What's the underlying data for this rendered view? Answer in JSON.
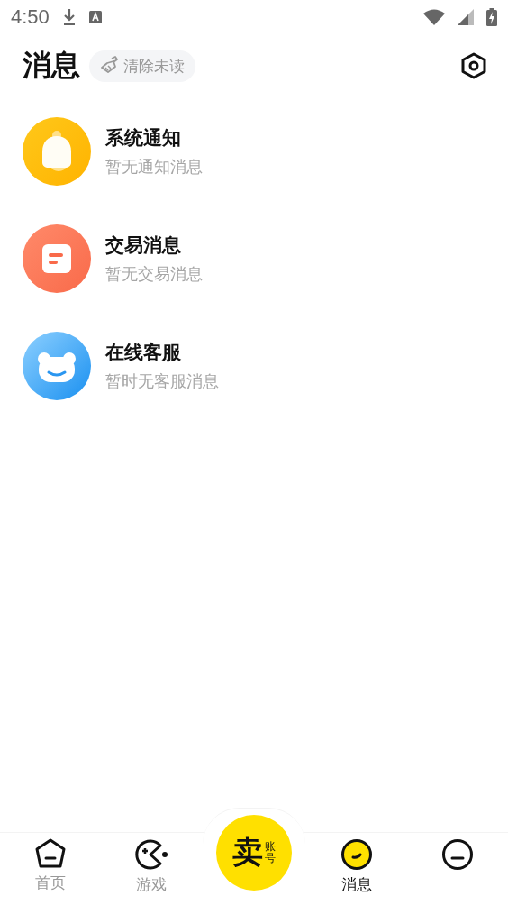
{
  "status_bar": {
    "time": "4:50"
  },
  "header": {
    "title": "消息",
    "clear_button": "清除未读"
  },
  "conversations": [
    {
      "kind": "notice",
      "title": "系统通知",
      "subtitle": "暂无通知消息"
    },
    {
      "kind": "trade",
      "title": "交易消息",
      "subtitle": "暂无交易消息"
    },
    {
      "kind": "service",
      "title": "在线客服",
      "subtitle": "暂时无客服消息"
    }
  ],
  "bottom_nav": [
    {
      "kind": "home",
      "label": "首页",
      "selected": false
    },
    {
      "kind": "game",
      "label": "游戏",
      "selected": false
    },
    {
      "kind": "sell",
      "label": "卖",
      "sublabel": "账号",
      "selected": false
    },
    {
      "kind": "message",
      "label": "消息",
      "selected": true
    },
    {
      "kind": "profile",
      "selected": false
    }
  ]
}
